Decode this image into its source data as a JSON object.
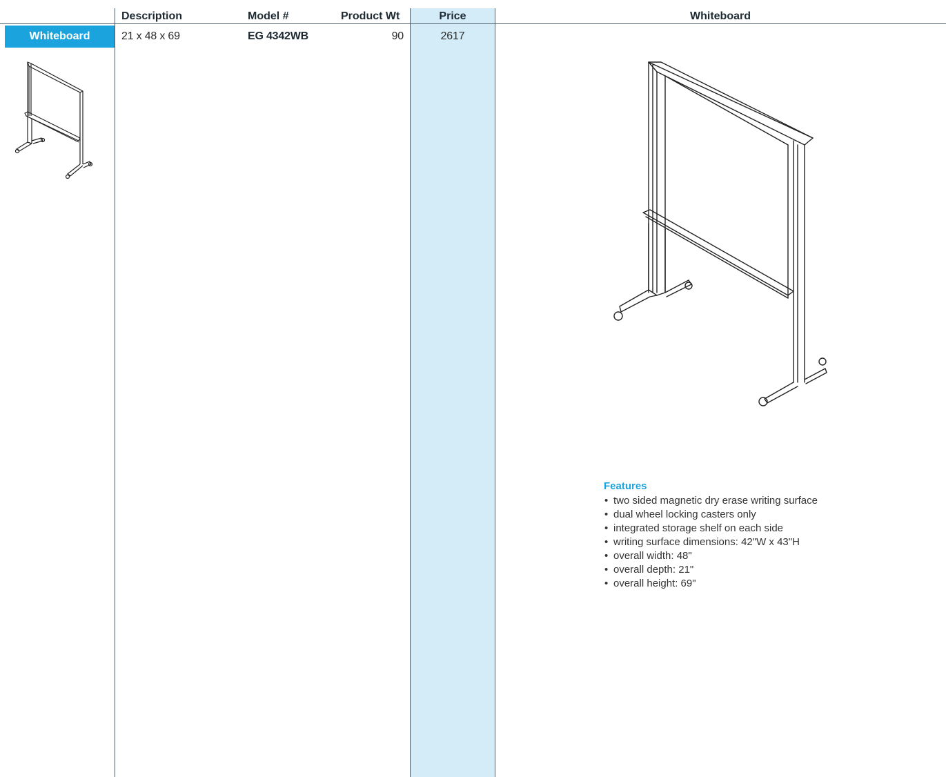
{
  "header": {
    "description": "Description",
    "model": "Model #",
    "weight": "Product Wt",
    "price": "Price",
    "image_title": "Whiteboard"
  },
  "category": {
    "label": "Whiteboard"
  },
  "product": {
    "description": "21 x 48 x 69",
    "model": "EG 4342WB",
    "weight": "90",
    "price": "2617"
  },
  "features": {
    "title": "Features",
    "items": [
      "two sided magnetic dry erase writing surface",
      "dual wheel locking casters only",
      "integrated storage shelf on each side",
      "writing surface dimensions: 42\"W x 43\"H",
      "overall width: 48\"",
      "overall depth: 21\"",
      "overall height: 69\""
    ]
  },
  "icons": {
    "thumbnail": "whiteboard-thumbnail-icon",
    "illustration": "whiteboard-illustration-icon",
    "bullet": "bullet-icon"
  },
  "colors": {
    "accent": "#1aa3dd",
    "price_column": "#d4ebf8",
    "rule": "#4a5a66"
  }
}
